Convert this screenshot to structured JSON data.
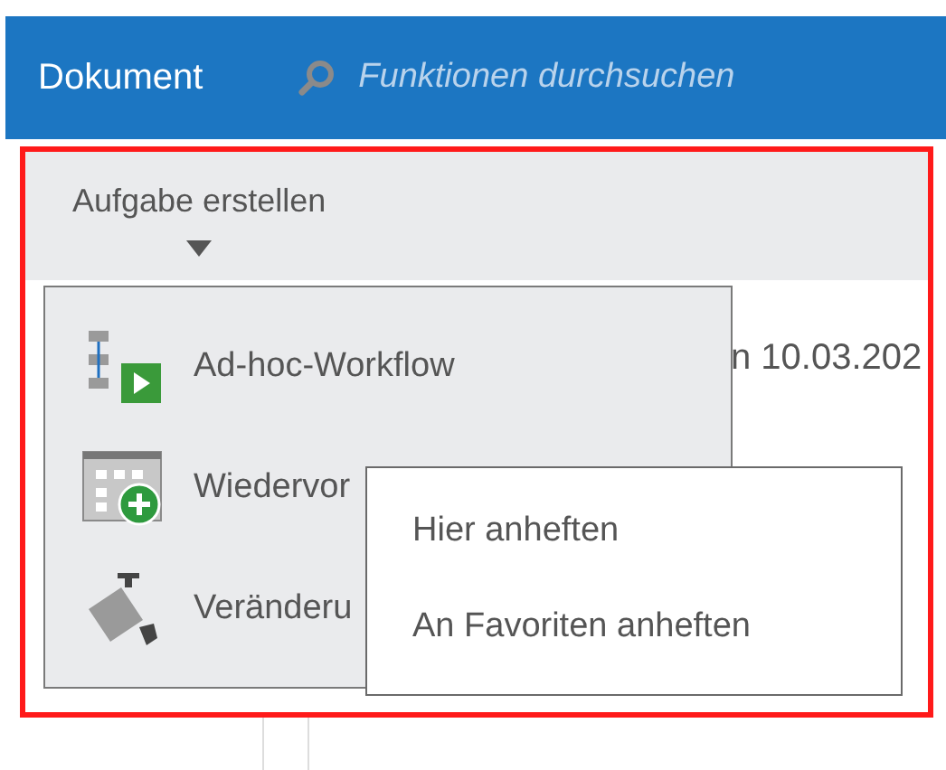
{
  "header": {
    "title": "Dokument",
    "search": {
      "placeholder": "Funktionen durchsuchen"
    }
  },
  "ribbon": {
    "button": {
      "label": "Aufgabe erstellen"
    }
  },
  "background": {
    "date_text": "n 10.03.202"
  },
  "dropdown": {
    "items": [
      {
        "label": "Ad-hoc-Workflow",
        "kind": "workflow"
      },
      {
        "label": "Wiedervor",
        "kind": "resubmission"
      },
      {
        "label": "Veränderu",
        "kind": "camera"
      }
    ]
  },
  "context_menu": {
    "items": [
      "Hier anheften",
      "An Favoriten anheften"
    ]
  }
}
